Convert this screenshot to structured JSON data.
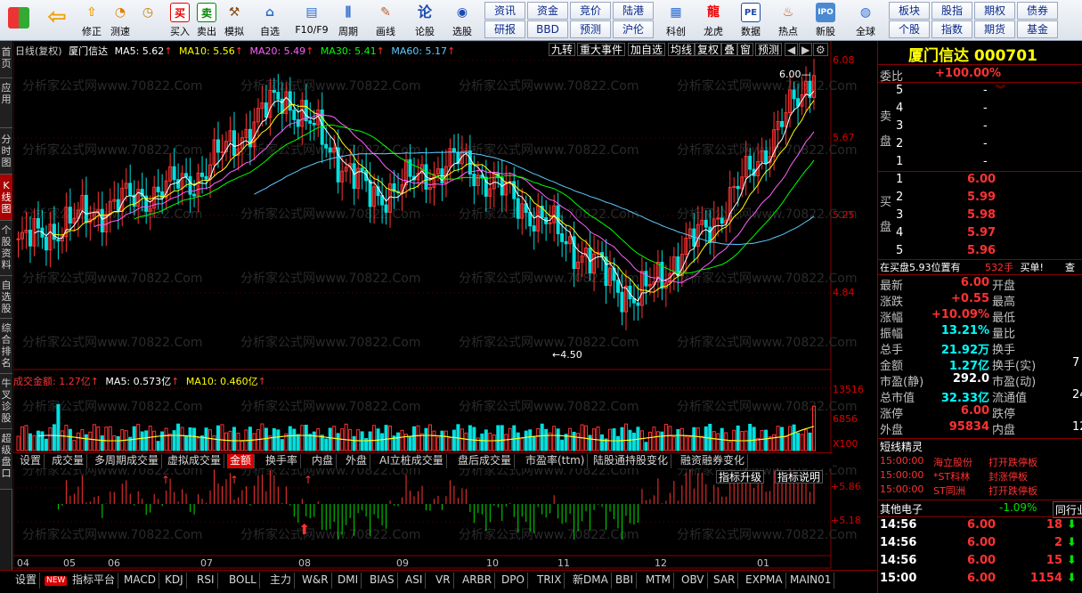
{
  "toolbar": {
    "items": [
      {
        "label": "",
        "icon": "grid-icon"
      },
      {
        "label": "",
        "icon": "back-arrow-icon"
      },
      {
        "label": "修正",
        "icon": "up-arrow-icon"
      },
      {
        "label": "测速",
        "icon": "speedometer-icon"
      },
      {
        "label": "买入",
        "icon": "buy-icon"
      },
      {
        "label": "卖出",
        "icon": "sell-icon"
      },
      {
        "label": "模拟",
        "icon": "hammer-icon"
      },
      {
        "label": "自选",
        "icon": "home-icon"
      },
      {
        "label": "F10/F9",
        "icon": "f10-icon"
      },
      {
        "label": "周期",
        "icon": "period-icon"
      },
      {
        "label": "画线",
        "icon": "pencil-icon"
      },
      {
        "label": "论股",
        "icon": "discuss-icon"
      },
      {
        "label": "选股",
        "icon": "pick-stock-icon"
      },
      {
        "label": "科创",
        "icon": "star-market-icon"
      },
      {
        "label": "龙虎",
        "icon": "dragon-tiger-icon"
      },
      {
        "label": "数据",
        "icon": "pe-icon"
      },
      {
        "label": "热点",
        "icon": "hot-icon"
      },
      {
        "label": "新股",
        "icon": "ipo-icon"
      },
      {
        "label": "全球",
        "icon": "globe-icon"
      }
    ],
    "squares": [
      [
        "资讯",
        "研报"
      ],
      [
        "资金",
        "BBD"
      ],
      [
        "竞价",
        "预测"
      ],
      [
        "陆港",
        "沪伦"
      ],
      [
        "板块",
        "个股"
      ],
      [
        "股指",
        "指数"
      ],
      [
        "期权",
        "期货"
      ],
      [
        "债券",
        "基金"
      ]
    ]
  },
  "left_strip": [
    "首页",
    "应用",
    "分时图",
    "K线图",
    "个股资料",
    "自选股",
    "综合排名",
    "牛叉诊股",
    "超级盘口"
  ],
  "chart": {
    "header": {
      "title": "日线(复权)",
      "name": "厦门信达",
      "ma5": "MA5: 5.62",
      "ma10": "MA10: 5.56",
      "ma20": "MA20: 5.49",
      "ma30": "MA30: 5.41",
      "ma60": "MA60: 5.17"
    },
    "top_buttons": [
      "九转",
      "重大事件",
      "加自选",
      "均线",
      "复权",
      "叠",
      "窗",
      "预测"
    ],
    "price_axis": [
      "6.08",
      "5.67",
      "5.25",
      "4.84"
    ],
    "hi_label": "6.00",
    "lo_label": "4.50",
    "volume_header": {
      "title": "成交金额: 1.27亿",
      "ma5": "MA5: 0.573亿",
      "ma10": "MA10: 0.460亿"
    },
    "vol_axis": [
      "13516",
      "6856",
      "X100"
    ],
    "indicator_tabs": [
      "设置",
      "成交量",
      "多周期成交量",
      "虚拟成交量",
      "金额",
      "换手率",
      "内盘",
      "外盘",
      "AI立桩成交量",
      "盘后成交量",
      "市盈率(ttm)",
      "陆股通持股变化",
      "融资融券变化"
    ],
    "indicator_buttons": [
      "指标升级",
      "指标说明"
    ],
    "ind_axis": [
      "+5.86",
      "+5.18"
    ],
    "months": [
      "04",
      "05",
      "06",
      "07",
      "08",
      "09",
      "10",
      "11",
      "12",
      "01"
    ],
    "watermark": "分析家公式网www.70822.Com"
  },
  "chart_data": {
    "type": "candlestick",
    "title": "",
    "ylim": [
      4.5,
      6.08
    ],
    "x": [
      "04",
      "05",
      "06",
      "07",
      "08",
      "09",
      "10",
      "11",
      "12",
      "01"
    ],
    "close": [
      5.1,
      5.3,
      5.45,
      5.9,
      5.35,
      5.55,
      5.2,
      4.8,
      5.3,
      6.0
    ],
    "series": [
      {
        "name": "MA5",
        "values": [
          5.1,
          5.28,
          5.42,
          5.8,
          5.4,
          5.52,
          5.22,
          4.9,
          5.3,
          5.62
        ]
      },
      {
        "name": "MA10",
        "values": [
          5.08,
          5.25,
          5.4,
          5.75,
          5.45,
          5.5,
          5.25,
          4.95,
          5.28,
          5.56
        ]
      },
      {
        "name": "MA20",
        "values": [
          5.05,
          5.2,
          5.35,
          5.65,
          5.5,
          5.45,
          5.3,
          5.05,
          5.25,
          5.49
        ]
      },
      {
        "name": "MA30",
        "values": [
          5.0,
          5.15,
          5.3,
          5.55,
          5.5,
          5.45,
          5.35,
          5.1,
          5.22,
          5.41
        ]
      },
      {
        "name": "MA60",
        "values": [
          4.95,
          5.05,
          5.2,
          5.4,
          5.45,
          5.42,
          5.35,
          5.15,
          5.1,
          5.17
        ]
      }
    ]
  },
  "right": {
    "title": "厦门信达 000701",
    "weibi_label": "委比",
    "weibi_value": "+100.00%",
    "sell_label": "卖盘",
    "sell_rows": [
      {
        "n": "5",
        "p": "-"
      },
      {
        "n": "4",
        "p": "-"
      },
      {
        "n": "3",
        "p": "-"
      },
      {
        "n": "2",
        "p": "-"
      },
      {
        "n": "1",
        "p": "-"
      }
    ],
    "buy_label": "买盘",
    "buy_rows": [
      {
        "n": "1",
        "p": "6.00"
      },
      {
        "n": "2",
        "p": "5.99"
      },
      {
        "n": "3",
        "p": "5.98"
      },
      {
        "n": "4",
        "p": "5.97"
      },
      {
        "n": "5",
        "p": "5.96"
      }
    ],
    "zaimai": "在买盘5.93位置有",
    "zaimai_qty": "532手",
    "zaimai_tag": "买单!",
    "zaimai_btn": "查",
    "stats_left": [
      {
        "k": "最新",
        "v": "6.00",
        "c": "red"
      },
      {
        "k": "涨跌",
        "v": "+0.55",
        "c": "red"
      },
      {
        "k": "涨幅",
        "v": "+10.09%",
        "c": "red"
      },
      {
        "k": "振幅",
        "v": "13.21%",
        "c": "cyan"
      },
      {
        "k": "总手",
        "v": "21.92万",
        "c": "cyan"
      },
      {
        "k": "金额",
        "v": "1.27亿",
        "c": "cyan"
      },
      {
        "k": "市盈(静)",
        "v": "292.0",
        "c": "white"
      },
      {
        "k": "总市值",
        "v": "32.33亿",
        "c": "cyan"
      },
      {
        "k": "涨停",
        "v": "6.00",
        "c": "red"
      },
      {
        "k": "外盘",
        "v": "95834",
        "c": "red"
      }
    ],
    "stats_right": [
      {
        "k": "开盘",
        "v": ""
      },
      {
        "k": "最高",
        "v": ""
      },
      {
        "k": "最低",
        "v": ""
      },
      {
        "k": "量比",
        "v": ""
      },
      {
        "k": "换手",
        "v": ""
      },
      {
        "k": "换手(实)",
        "v": "7"
      },
      {
        "k": "市盈(动)",
        "v": ""
      },
      {
        "k": "流通值",
        "v": "24"
      },
      {
        "k": "跌停",
        "v": ""
      },
      {
        "k": "内盘",
        "v": "12"
      }
    ],
    "short_title": "短线精灵",
    "short_rows": [
      {
        "time": "15:00:00",
        "name": "海立股份",
        "event": "打开跌停板"
      },
      {
        "time": "15:00:00",
        "name": "*ST科林",
        "event": "封涨停板"
      },
      {
        "time": "15:00:00",
        "name": "ST同洲",
        "event": "打开跌停板"
      }
    ],
    "sector_name": "其他电子",
    "sector_change": "-1.09%",
    "sector_btn": "同行业",
    "ticks": [
      {
        "time": "14:56",
        "price": "6.00",
        "vol": "18"
      },
      {
        "time": "14:56",
        "price": "6.00",
        "vol": "2"
      },
      {
        "time": "14:56",
        "price": "6.00",
        "vol": "15"
      },
      {
        "time": "15:00",
        "price": "6.00",
        "vol": "1154"
      }
    ]
  },
  "bottom_tabs": [
    "设置",
    "NEW",
    "指标平台",
    "MACD",
    "KDJ",
    "RSI",
    "BOLL",
    "主力",
    "W&R",
    "DMI",
    "BIAS",
    "ASI",
    "VR",
    "ARBR",
    "DPO",
    "TRIX",
    "新DMA",
    "BBI",
    "MTM",
    "OBV",
    "SAR",
    "EXPMA",
    "MAIN01"
  ]
}
